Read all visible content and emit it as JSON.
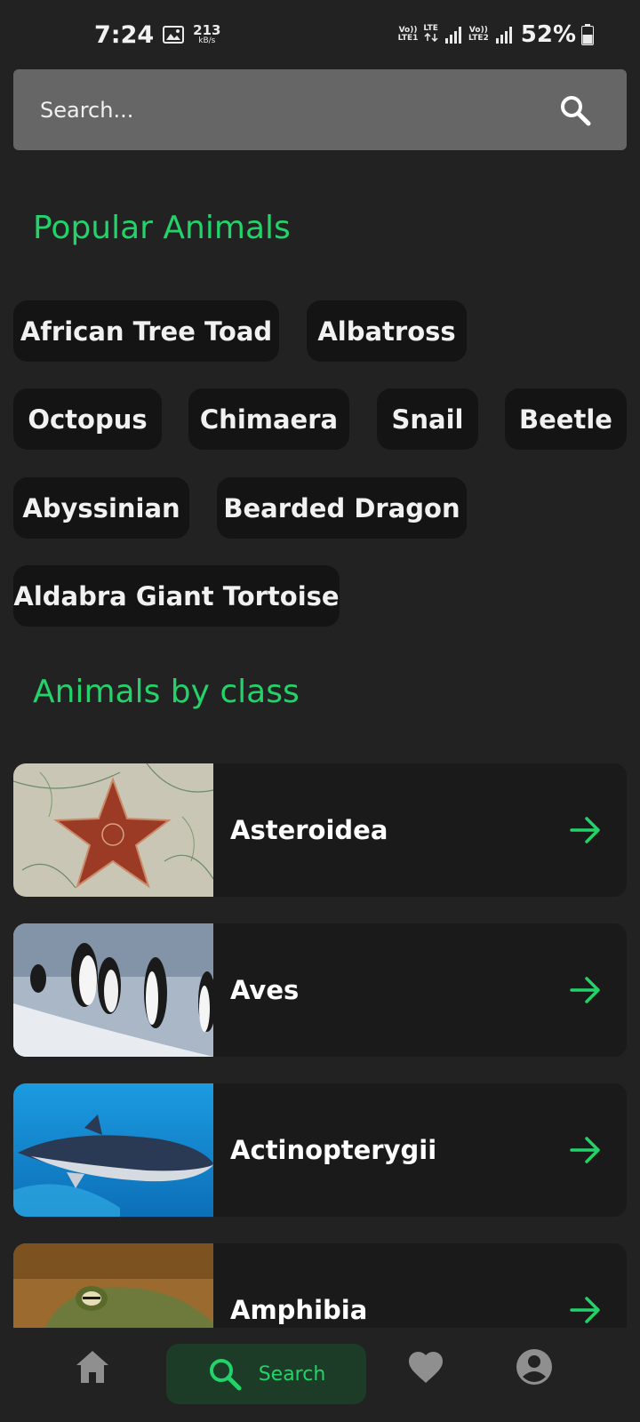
{
  "status_bar": {
    "time": "7:24",
    "speed_value": "213",
    "speed_unit": "kB/s",
    "sim1_label_top": "Vo))",
    "sim1_label_bottom": "LTE1",
    "lte_label": "LTE",
    "sim2_label_top": "Vo))",
    "sim2_label_bottom": "LTE2",
    "battery": "52%"
  },
  "search": {
    "placeholder": "Search..."
  },
  "popular": {
    "title": "Popular Animals",
    "chips": [
      "African Tree Toad",
      "Albatross",
      "Octopus",
      "Chimaera",
      "Snail",
      "Beetle",
      "Abyssinian",
      "Bearded Dragon",
      "Aldabra Giant Tortoise"
    ]
  },
  "classes": {
    "title": "Animals by class",
    "items": [
      {
        "name": "Asteroidea",
        "image": "starfish-photo"
      },
      {
        "name": "Aves",
        "image": "penguins-photo"
      },
      {
        "name": "Actinopterygii",
        "image": "tuna-photo"
      },
      {
        "name": "Amphibia",
        "image": "frog-photo"
      }
    ]
  },
  "bottom_nav": {
    "search_label": "Search"
  },
  "colors": {
    "accent": "#22d36a",
    "background": "#222222",
    "card": "#1a1a1a",
    "chip": "#141414",
    "search_bar": "#666666"
  }
}
